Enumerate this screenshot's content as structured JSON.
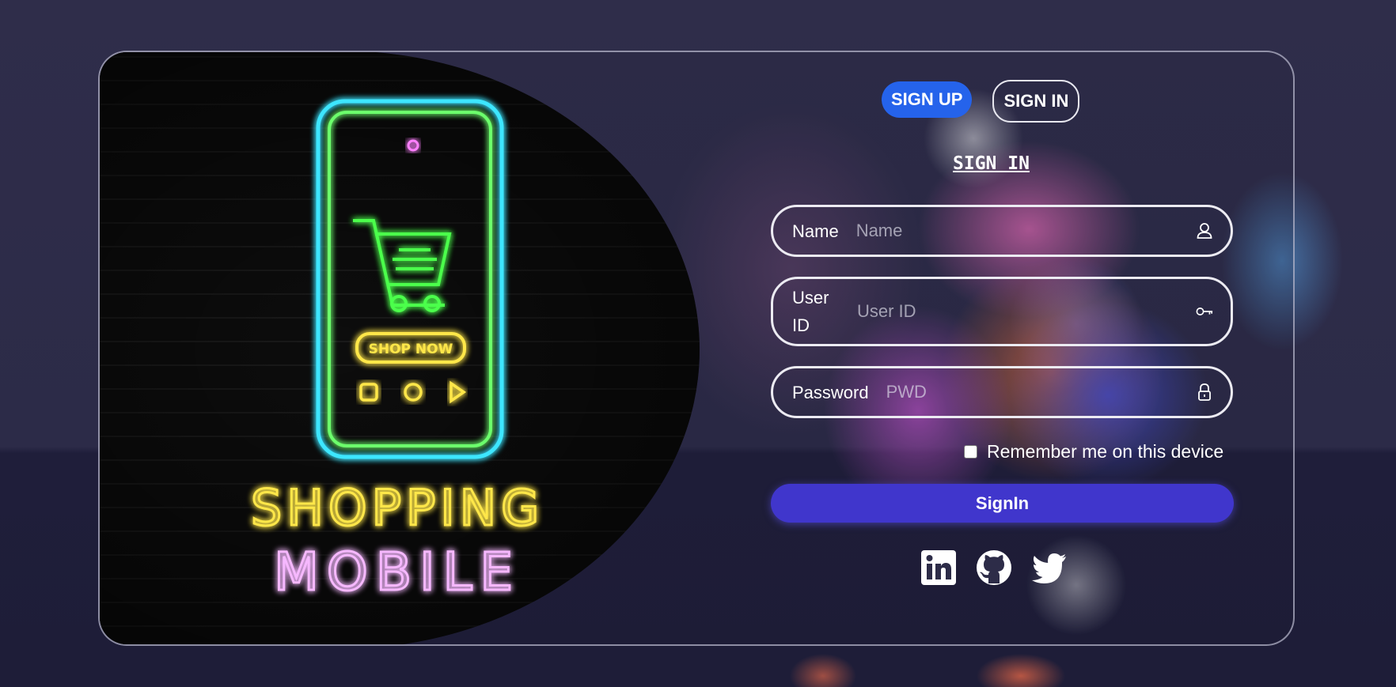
{
  "hero": {
    "line1": "SHOPPING",
    "line2": "MOBILE",
    "button_text": "SHOP NOW"
  },
  "tabs": {
    "signup": "SIGN UP",
    "signin": "SIGN IN"
  },
  "form": {
    "title": "SIGN IN",
    "name": {
      "label": "Name",
      "placeholder": "Name",
      "icon": "user-icon"
    },
    "user_id": {
      "label": "User ID",
      "placeholder": "User ID",
      "icon": "key-icon"
    },
    "password": {
      "label": "Password",
      "placeholder": "PWD",
      "icon": "lock-icon"
    },
    "remember": {
      "label": "Remember me on this device",
      "checked": false
    },
    "submit": "SignIn"
  },
  "socials": [
    "linkedin-icon",
    "github-icon",
    "twitter-icon"
  ],
  "colors": {
    "signup_tab": "#2563eb",
    "submit_button": "#4036cc",
    "neon_cyan": "#3ee6ff",
    "neon_green": "#6cff6c",
    "neon_yellow": "#ffe74a",
    "neon_pink": "#f6b8ff"
  }
}
